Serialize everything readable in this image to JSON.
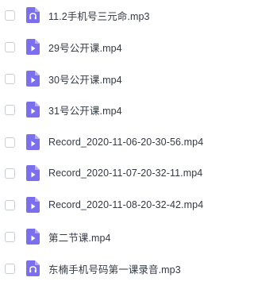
{
  "files": [
    {
      "name": "11.2手机号三元命.mp3",
      "type": "audio",
      "icon": "headphones-icon",
      "icon_color": "#7b6ff0"
    },
    {
      "name": "29号公开课.mp4",
      "type": "video",
      "icon": "play-icon",
      "icon_color": "#7b6ff0"
    },
    {
      "name": "30号公开课.mp4",
      "type": "video",
      "icon": "play-icon",
      "icon_color": "#7b6ff0"
    },
    {
      "name": "31号公开课.mp4",
      "type": "video",
      "icon": "play-icon",
      "icon_color": "#7b6ff0"
    },
    {
      "name": "Record_2020-11-06-20-30-56.mp4",
      "type": "video",
      "icon": "play-icon",
      "icon_color": "#7b6ff0"
    },
    {
      "name": "Record_2020-11-07-20-32-11.mp4",
      "type": "video",
      "icon": "play-icon",
      "icon_color": "#7b6ff0"
    },
    {
      "name": "Record_2020-11-08-20-32-42.mp4",
      "type": "video",
      "icon": "play-icon",
      "icon_color": "#7b6ff0"
    },
    {
      "name": "第二节课.mp4",
      "type": "video",
      "icon": "play-icon",
      "icon_color": "#7b6ff0"
    },
    {
      "name": "东楠手机号码第一课录音.mp3",
      "type": "audio",
      "icon": "headphones-icon",
      "icon_color": "#7b6ff0"
    }
  ]
}
